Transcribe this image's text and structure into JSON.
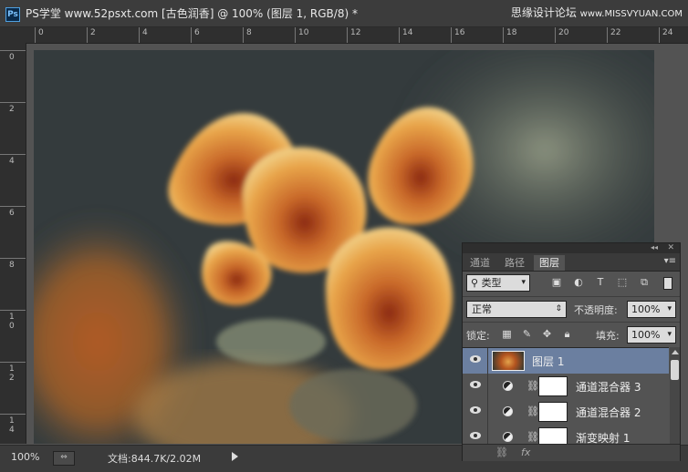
{
  "window": {
    "app_icon": "Ps",
    "title": "PS学堂 www.52psxt.com [古色润香] @ 100% (图层 1, RGB/8) *",
    "watermark_main": "思缘设计论坛",
    "watermark_sub": "www.MISSVYUAN.COM"
  },
  "ruler": {
    "top_labels": [
      "0",
      "2",
      "4",
      "6",
      "8",
      "10",
      "12",
      "14",
      "16",
      "18",
      "20",
      "22",
      "24"
    ],
    "left_labels": [
      "0",
      "2",
      "4",
      "6",
      "8",
      "10",
      "12",
      "14"
    ]
  },
  "status": {
    "zoom": "100%",
    "doc_info": "文档:844.7K/2.02M"
  },
  "layers_panel": {
    "tabs": [
      "通道",
      "路径",
      "图层"
    ],
    "active_tab": "图层",
    "filter_label": "类型",
    "blend_mode": "正常",
    "opacity_label": "不透明度:",
    "opacity_value": "100%",
    "lock_label": "锁定:",
    "fill_label": "填充:",
    "fill_value": "100%",
    "layers": [
      {
        "name": "图层 1",
        "type": "pixel",
        "selected": true
      },
      {
        "name": "通道混合器 3",
        "type": "adjustment",
        "selected": false
      },
      {
        "name": "通道混合器 2",
        "type": "adjustment",
        "selected": false
      },
      {
        "name": "渐变映射 1",
        "type": "adjustment",
        "selected": false
      }
    ],
    "footer_icons": [
      "link-icon",
      "fx-icon"
    ],
    "footer_fx": "fx"
  },
  "colors": {
    "selected_layer": "#6b7fa0",
    "panel_bg": "#535353",
    "flower_orange": "#e8a449",
    "flower_red": "#8c2a12"
  }
}
